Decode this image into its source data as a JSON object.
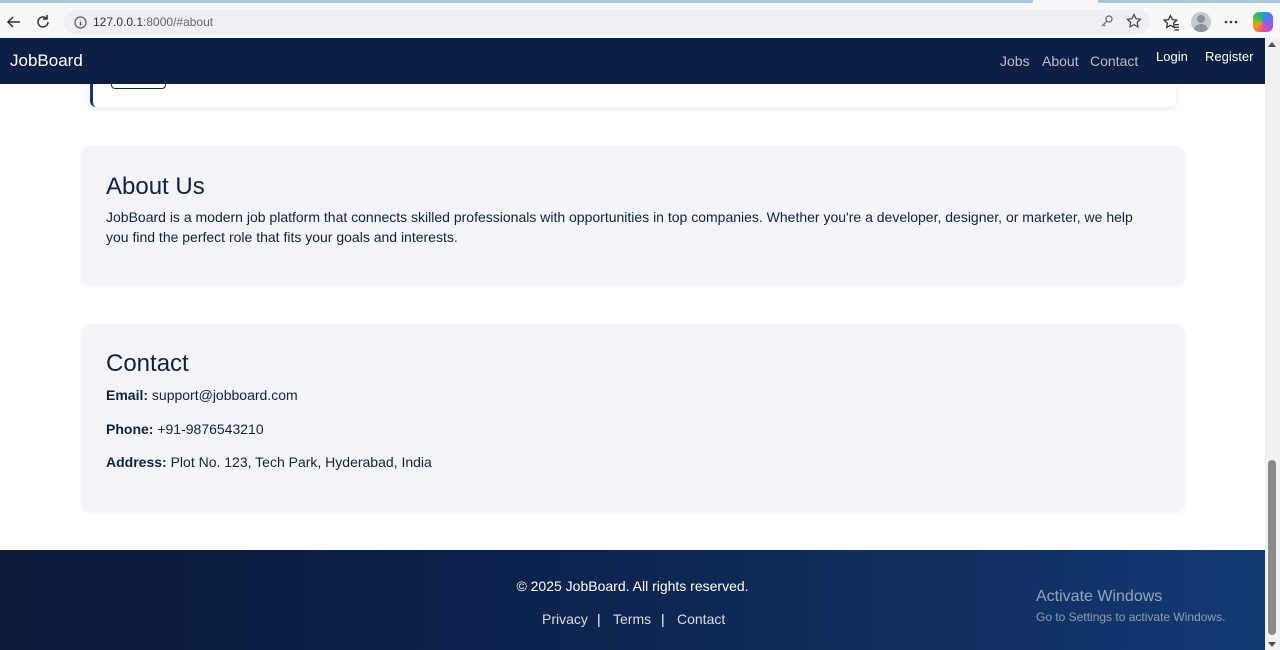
{
  "browser": {
    "url_host": "127.0.0.1",
    "url_rest": ":8000/#about",
    "icons": [
      "back-icon",
      "reload-icon",
      "info-icon",
      "key-icon",
      "star-icon",
      "favorites-icon",
      "profile-icon",
      "more-icon",
      "copilot-icon"
    ]
  },
  "header": {
    "brand": "JobBoard",
    "nav": {
      "jobs": "Jobs",
      "about": "About",
      "contact": "Contact"
    },
    "auth": {
      "login": "Login",
      "register": "Register"
    },
    "colors": {
      "background": "#0b1f44",
      "nav_text": "#b7c0cf"
    }
  },
  "about": {
    "title": "About Us",
    "text": "JobBoard is a modern job platform that connects skilled professionals with opportunities in top companies. Whether you're a developer, designer, or marketer, we help you find the perfect role that fits your goals and interests."
  },
  "contact": {
    "title": "Contact",
    "email_label": "Email:",
    "email_value": "support@jobboard.com",
    "phone_label": "Phone:",
    "phone_value": "+91-9876543210",
    "address_label": "Address:",
    "address_value": "Plot No. 123, Tech Park, Hyderabad, India"
  },
  "footer": {
    "copyright": "© 2025 JobBoard. All rights reserved.",
    "links": {
      "privacy": "Privacy",
      "terms": "Terms",
      "contact": "Contact"
    },
    "separator": "|"
  },
  "watermark": {
    "title": "Activate Windows",
    "subtitle": "Go to Settings to activate Windows."
  }
}
